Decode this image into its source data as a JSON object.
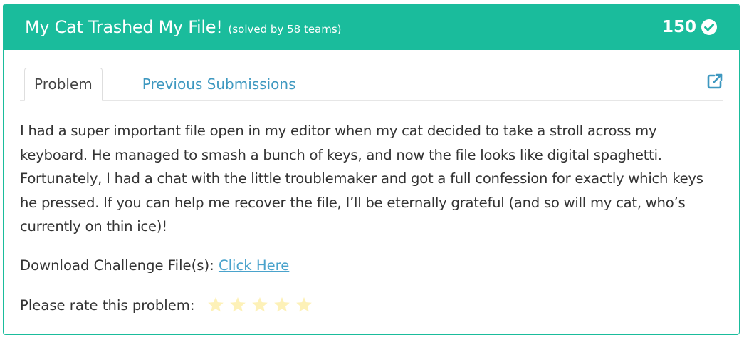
{
  "challenge": {
    "title": "My Cat Trashed My File!",
    "solved_text": "(solved by 58 teams)",
    "points": "150",
    "solved_icon": "check-circle-icon"
  },
  "tabs": [
    {
      "label": "Problem",
      "active": true
    },
    {
      "label": "Previous Submissions",
      "active": false
    }
  ],
  "external_link_icon": "external-link-icon",
  "description": "I had a super important file open in my editor when my cat decided to take a stroll across my keyboard. He managed to smash a bunch of keys, and now the file looks like digital spaghetti. Fortunately, I had a chat with the little troublemaker and got a full confession for exactly which keys he pressed. If you can help me recover the file, I’ll be eternally grateful (and so will my cat, who’s currently on thin ice)!",
  "download": {
    "label": "Download Challenge File(s):",
    "link_text": "Click Here"
  },
  "rating": {
    "label": "Please rate this problem:",
    "max_stars": 5,
    "filled_stars": 0
  },
  "colors": {
    "accent": "#1abc9c",
    "link": "#3e98c0",
    "star": "#fdf1b8"
  }
}
